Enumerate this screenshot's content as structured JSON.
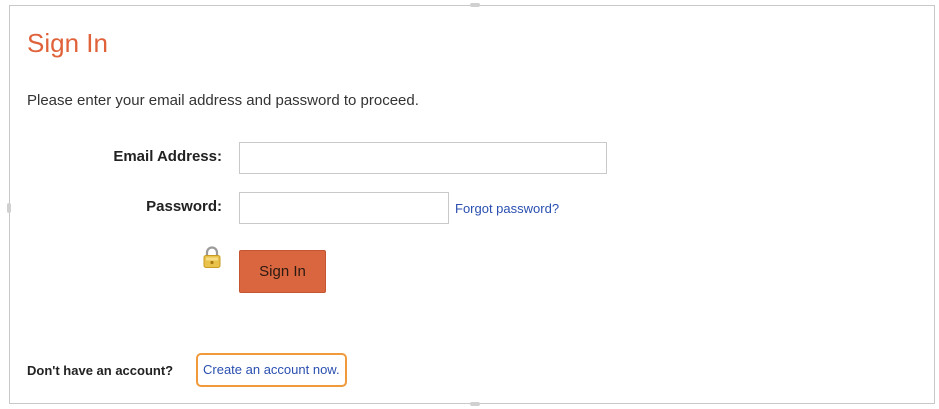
{
  "page": {
    "title": "Sign In",
    "instructions": "Please enter your email address and password to proceed."
  },
  "form": {
    "email_label": "Email Address:",
    "email_value": "",
    "password_label": "Password:",
    "password_value": "",
    "forgot_link": "Forgot password?",
    "lock_icon": "lock-icon",
    "signin_label": "Sign In"
  },
  "footer": {
    "no_account_text": "Don't have an account?",
    "create_link": "Create an account now."
  },
  "colors": {
    "title": "#e0623a",
    "button": "#d9663f",
    "link": "#2a4fb0",
    "highlight": "#f09a3c"
  }
}
